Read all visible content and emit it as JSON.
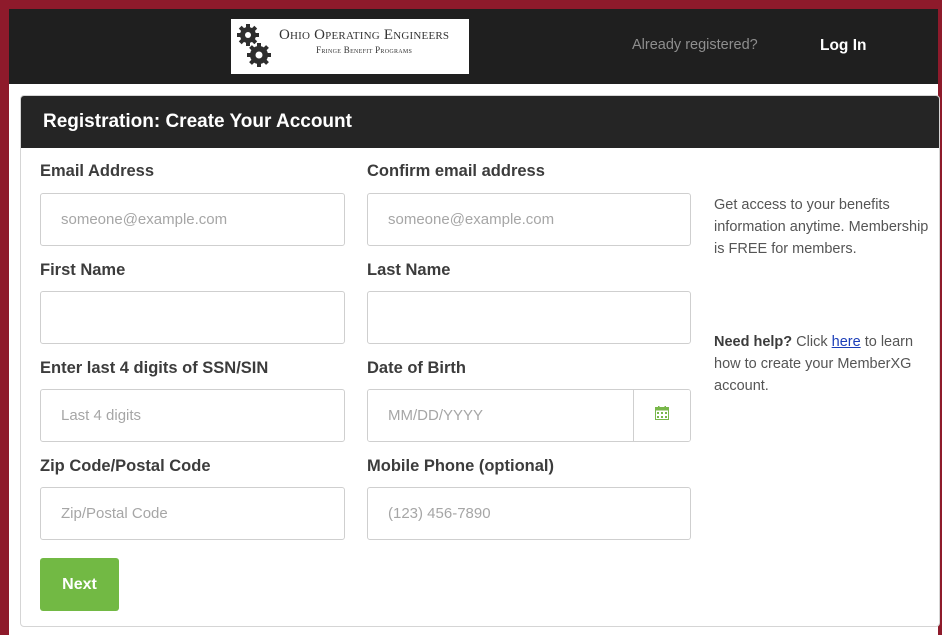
{
  "header": {
    "logo": {
      "title": "Ohio Operating Engineers",
      "subtitle": "Fringe Benefit Programs"
    },
    "already_registered": "Already registered?",
    "login_label": "Log In"
  },
  "panel": {
    "title": "Registration: Create Your Account"
  },
  "form": {
    "email": {
      "label": "Email Address",
      "placeholder": "someone@example.com",
      "value": ""
    },
    "confirm_email": {
      "label": "Confirm email address",
      "placeholder": "someone@example.com",
      "value": ""
    },
    "first_name": {
      "label": "First Name",
      "placeholder": "",
      "value": ""
    },
    "last_name": {
      "label": "Last Name",
      "placeholder": "",
      "value": ""
    },
    "ssn": {
      "label": "Enter last 4 digits of SSN/SIN",
      "placeholder": "Last 4 digits",
      "value": ""
    },
    "dob": {
      "label": "Date of Birth",
      "placeholder": "MM/DD/YYYY",
      "value": ""
    },
    "zip": {
      "label": "Zip Code/Postal Code",
      "placeholder": "Zip/Postal Code",
      "value": ""
    },
    "phone": {
      "label": "Mobile Phone (optional)",
      "placeholder": "(123) 456-7890",
      "value": ""
    },
    "next_label": "Next"
  },
  "sidebar": {
    "info_text": "Get access to your benefits information anytime. Membership is FREE for members.",
    "help_strong": "Need help?",
    "help_pre": " Click ",
    "help_link": "here",
    "help_post": " to learn how to create your MemberXG account."
  },
  "colors": {
    "frame": "#8e1a2b",
    "topbar": "#1f1f1f",
    "panel_header": "#252525",
    "next_button": "#72b944",
    "link": "#1a3db8",
    "calendar_icon": "#78b74a"
  },
  "icons": {
    "logo": "gears-logo-icon",
    "calendar": "calendar-icon"
  }
}
